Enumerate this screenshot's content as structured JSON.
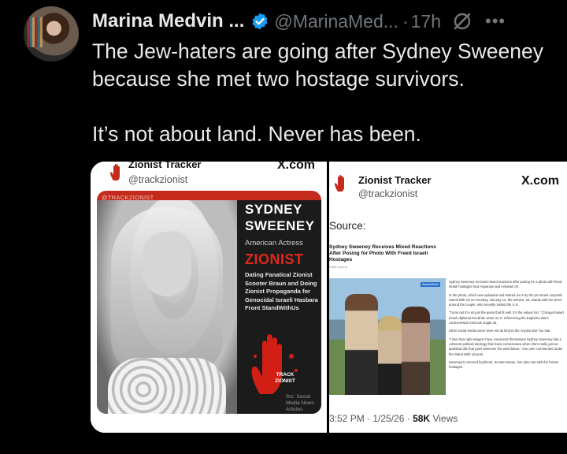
{
  "tweet": {
    "display_name": "Marina Medvin ...",
    "handle": "@MarinaMed...",
    "separator": "·",
    "time": "17h",
    "more": "•••",
    "text_lines": [
      "The Jew-haters are going after Sydney Sweeney",
      "because she met two hostage survivors."
    ],
    "text_line_2": "It’s not about land. Never has been."
  },
  "media_left": {
    "account_name": "Zionist Tracker",
    "account_handle": "@trackzionist",
    "brand": "X.com",
    "poster": {
      "tag": "@TRACKZIONIST",
      "name_line1": "SYDNEY",
      "name_line2": "SWEENEY",
      "role": "American Actress",
      "label": "ZIONIST",
      "description": "Dating Fanatical Zionist Scooter Braun and Doing Zionist Propaganda for Genocidal Israeli Hasbara Front StandWithUs",
      "stamp": "TRACK ZIONIST",
      "source_note": "Src: Social Media News Articles"
    }
  },
  "media_right": {
    "account_name": "Zionist Tracker",
    "account_handle": "@trackzionist",
    "brand": "X.com",
    "source_label": "Source:",
    "article": {
      "headline": "Sydney Sweeney Receives Mixed Reactions After Posing for Photo With Freed Israeli Hostages",
      "byline": "Katie Kotona",
      "badge": "StandWithUs",
      "paragraphs": [
        "Sydney Sweeney received mixed reactions after posing for a photo with freed Israeli hostages Noa Argamani and Avinatan Or.",
        "In the photo, which was uploaded and shared via X by the pro-Israel nonprofit Stand With Us on Tuesday, January 13, the actress, 28, stands with her arms around the couple, who recently visited the U.S.",
        "\"Turns out it's not just the jeans that fit well. It's the values too,\" Chicago-based Israeli diplomat Kai Brian wrote on X, referencing the Euphoria star's controversial American Eagle ad.",
        "Other social media users were not as kind to the Anyone But You star.",
        "\"I love how right wingers have convinced themselves Sydney Sweeney has a coherent political ideology that leans conservative when she's really just an apolitical ditz that goes wherever the wind blows,\" one user commented under the Stand With Us post.",
        "Sweeney's rumored boyfriend, Scooter Braun, has also met with the former hostages."
      ]
    },
    "timestamp": "3:52 PM · 1/25/26 ·",
    "views_count": "58K",
    "views_label": "Views"
  },
  "colors": {
    "background": "#000000",
    "text_primary": "#e7e9ea",
    "text_secondary": "#71767b",
    "verified_blue": "#1d9bf0",
    "poster_red": "#c42b1c",
    "zionist_red": "#e0281c"
  },
  "icons": [
    "verified-badge-icon",
    "grok-icon",
    "more-icon",
    "red-hand-icon"
  ]
}
